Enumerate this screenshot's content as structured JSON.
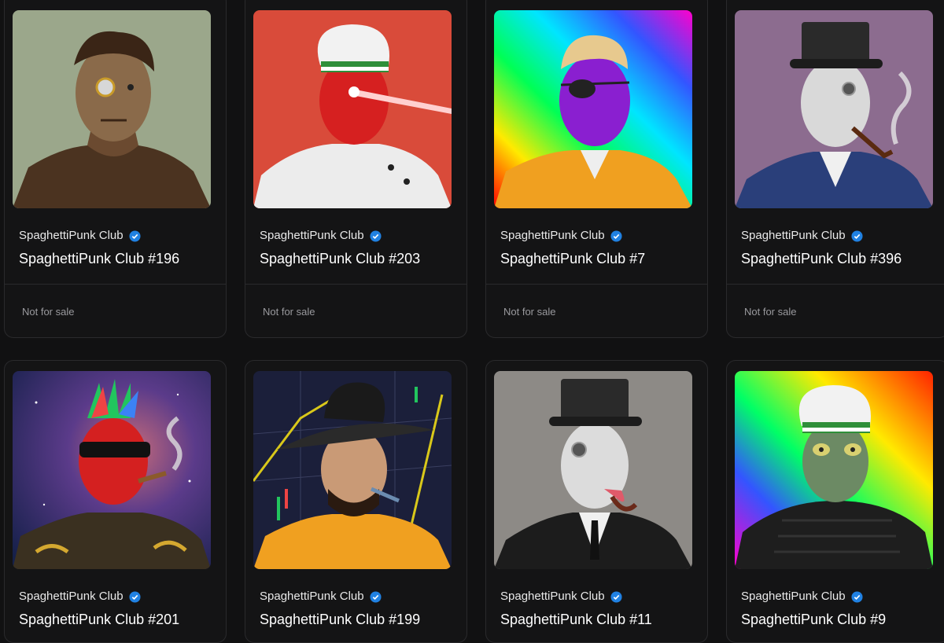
{
  "cards": [
    {
      "collection": "SpaghettiPunk Club",
      "name": "SpaghettiPunk Club #196",
      "status": "Not for sale",
      "bg": "#9ba78b"
    },
    {
      "collection": "SpaghettiPunk Club",
      "name": "SpaghettiPunk Club #203",
      "status": "Not for sale",
      "bg": "#d94b3a"
    },
    {
      "collection": "SpaghettiPunk Club",
      "name": "SpaghettiPunk Club #7",
      "status": "Not for sale",
      "bg": "rainbow"
    },
    {
      "collection": "SpaghettiPunk Club",
      "name": "SpaghettiPunk Club #396",
      "status": "Not for sale",
      "bg": "#8c6c8f"
    },
    {
      "collection": "SpaghettiPunk Club",
      "name": "SpaghettiPunk Club #201",
      "status": "",
      "bg": "space"
    },
    {
      "collection": "SpaghettiPunk Club",
      "name": "SpaghettiPunk Club #199",
      "status": "",
      "bg": "chart"
    },
    {
      "collection": "SpaghettiPunk Club",
      "name": "SpaghettiPunk Club #11",
      "status": "",
      "bg": "#8d8a86"
    },
    {
      "collection": "SpaghettiPunk Club",
      "name": "SpaghettiPunk Club #9",
      "status": "",
      "bg": "rainbow"
    }
  ],
  "colors": {
    "verified": "#2081e2",
    "page_bg": "#111112",
    "card_border": "#2a2a2c",
    "muted": "#9a9a9e"
  },
  "icons": {
    "verified": "verified-badge-icon"
  }
}
